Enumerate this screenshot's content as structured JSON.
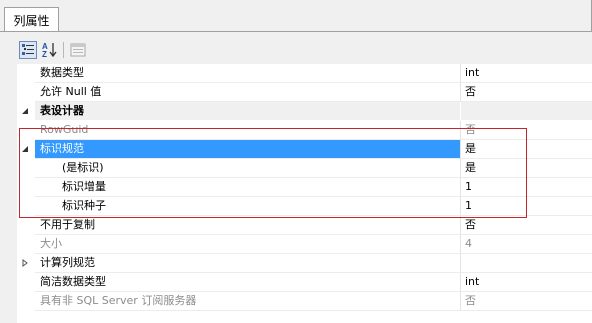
{
  "tab": {
    "label": "列属性"
  },
  "toolbar": {
    "categorized_icon": "categorized-view-icon",
    "alphabetical_icon": "alphabetical-sort-icon",
    "property_pages_icon": "property-pages-icon"
  },
  "grid": {
    "rows": [
      {
        "name": "数据类型",
        "value": "int"
      },
      {
        "name": "允许 Null 值",
        "value": "否"
      },
      {
        "name": "表设计器",
        "value": ""
      },
      {
        "name": "RowGuid",
        "value": "否"
      },
      {
        "name": "标识规范",
        "value": "是"
      },
      {
        "name": "(是标识)",
        "value": "是"
      },
      {
        "name": "标识增量",
        "value": "1"
      },
      {
        "name": "标识种子",
        "value": "1"
      },
      {
        "name": "不用于复制",
        "value": "否"
      },
      {
        "name": "大小",
        "value": "4"
      },
      {
        "name": "计算列规范",
        "value": ""
      },
      {
        "name": "简洁数据类型",
        "value": "int"
      },
      {
        "name": "具有非 SQL Server 订阅服务器",
        "value": "否"
      }
    ]
  },
  "colors": {
    "selection": "#3399ff",
    "highlight_border": "#c0282d"
  }
}
